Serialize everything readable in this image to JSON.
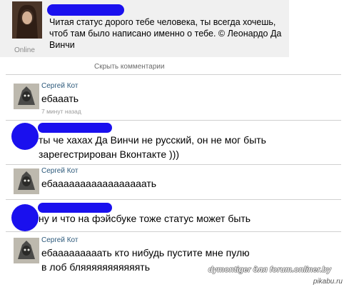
{
  "status": {
    "online_label": "Online",
    "text": "Читая статус дорого тебе человека, ты всегда хочешь, чтоб там было написано именно о тебе. © Леонардо Да Винчи"
  },
  "hide_comments_label": "Скрыть комментарии",
  "comments": [
    {
      "author": "Сергей Кот",
      "text": "ебааать",
      "time": "7 минут назад"
    },
    {
      "author": "",
      "text": "ты че хахах Да Винчи не русский, он не мог быть зарегестрирован Вконтакте )))"
    },
    {
      "author": "Сергей Кот",
      "text": "ебааааааааааааааааать"
    },
    {
      "author": "",
      "text": "ну и что на фэйсбуке тоже статус может быть"
    },
    {
      "author": "Сергей Кот",
      "text": "ебааааааааать кто нибудь пустите мне пулю в лоб бляяяяяяяяяяять"
    }
  ],
  "watermark": "dymontiger для forum.onliner.by",
  "site_mark": "pikabu.ru",
  "colors": {
    "blur": "#1a10ee",
    "author_link": "#2b587a",
    "status_bg": "#f0f0f0"
  }
}
